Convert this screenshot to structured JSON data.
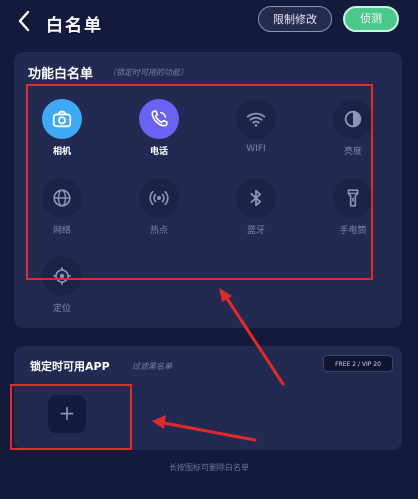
{
  "header": {
    "title": "白名单",
    "limit_button": "限制修改",
    "detect_button": "侦测"
  },
  "function_whitelist": {
    "title": "功能白名单",
    "subtitle": "（锁定时可用的功能）",
    "items": [
      {
        "label": "相机",
        "icon": "camera-icon",
        "active": true
      },
      {
        "label": "电话",
        "icon": "phone-icon",
        "active": true
      },
      {
        "label": "WIFI",
        "icon": "wifi-icon",
        "active": false
      },
      {
        "label": "亮度",
        "icon": "brightness-icon",
        "active": false
      },
      {
        "label": "网络",
        "icon": "globe-icon",
        "active": false
      },
      {
        "label": "热点",
        "icon": "hotspot-icon",
        "active": false
      },
      {
        "label": "蓝牙",
        "icon": "bluetooth-icon",
        "active": false
      },
      {
        "label": "手电筒",
        "icon": "flashlight-icon",
        "active": false
      },
      {
        "label": "定位",
        "icon": "location-icon",
        "active": false
      }
    ]
  },
  "app_whitelist": {
    "title": "锁定时可用APP",
    "subtitle": "过滤黑名单",
    "badge": "FREE 2 / VIP 20",
    "add_symbol": "+"
  },
  "footer_hint": "长按图标可删除白名单",
  "colors": {
    "background": "#141a3c",
    "card": "#222a52",
    "accent_green": "#4cc98a",
    "camera_blue": "#3fa9f5",
    "phone_purple": "#6a62f0",
    "annotation_red": "#e12a2a"
  }
}
